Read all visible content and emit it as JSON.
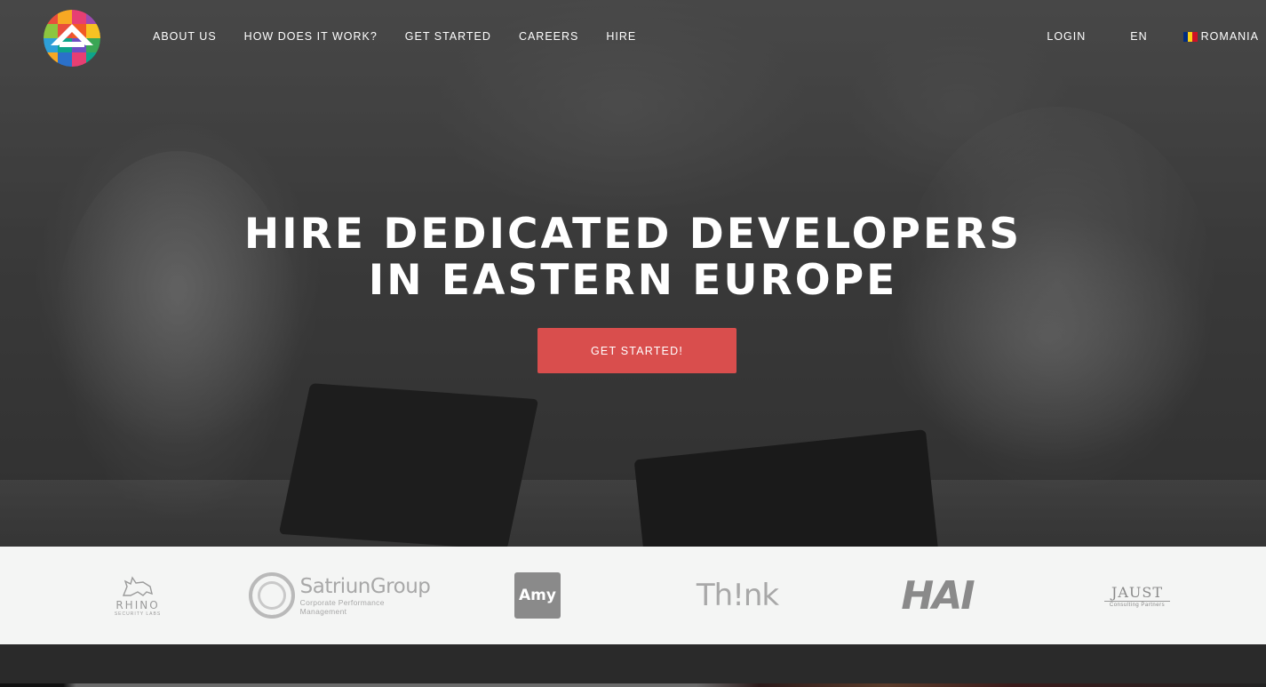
{
  "nav": {
    "links": [
      "ABOUT US",
      "HOW DOES IT WORK?",
      "GET STARTED",
      "CAREERS",
      "HIRE"
    ],
    "login": "LOGIN",
    "language": "EN",
    "country": "ROMANIA"
  },
  "hero": {
    "line1": "HIRE DEDICATED DEVELOPERS",
    "line2": "IN EASTERN EUROPE",
    "cta": "GET STARTED!"
  },
  "clients": {
    "rhino": {
      "name": "RHINO",
      "sub": "SECURITY LABS"
    },
    "satriun": {
      "name": "SatriunGroup",
      "sub": "Corporate Performance Management"
    },
    "amy": {
      "name": "Amy"
    },
    "think": {
      "name": "Th!nk"
    },
    "hai": {
      "name": "HAI"
    },
    "jaust": {
      "name": "JAUST",
      "sub": "Consulting Partners"
    }
  },
  "colors": {
    "accent": "#d94e4d",
    "flag": [
      "#002b7f",
      "#fcd116",
      "#ce1126"
    ]
  }
}
